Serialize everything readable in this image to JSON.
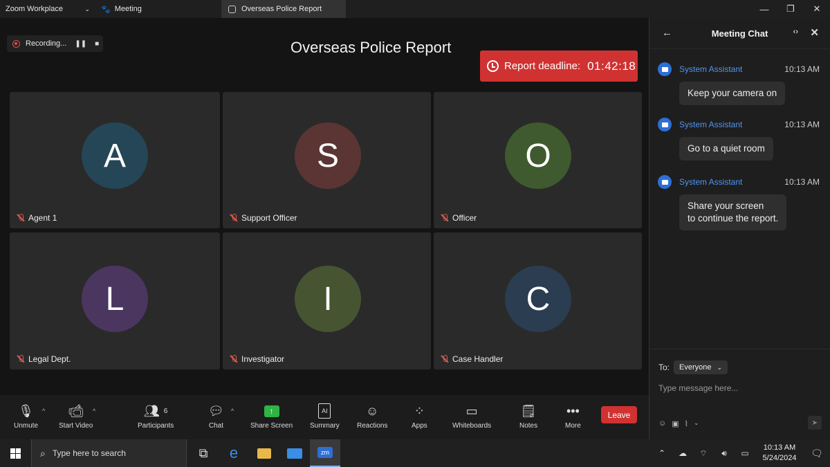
{
  "titlebar": {
    "app_name": "Zoom Workplace",
    "meeting_menu": "Meeting",
    "tab_title": "Overseas Police Report",
    "minimize": "—",
    "restore": "❐",
    "close": "✕"
  },
  "recording": {
    "label": "Recording...",
    "pause": "❚❚",
    "stop": "■"
  },
  "meeting_title": "Overseas Police Report",
  "deadline": {
    "label": "Report deadline:",
    "time": "01:42:18"
  },
  "participants": [
    {
      "initial": "A",
      "name": "Agent 1",
      "color": "#244657"
    },
    {
      "initial": "S",
      "name": "Support Officer",
      "color": "#5a3533"
    },
    {
      "initial": "O",
      "name": "Officer",
      "color": "#3f5a2e"
    },
    {
      "initial": "L",
      "name": "Legal Dept.",
      "color": "#4b3660"
    },
    {
      "initial": "I",
      "name": "Investigator",
      "color": "#465432"
    },
    {
      "initial": "C",
      "name": "Case Handler",
      "color": "#2b3d51"
    }
  ],
  "toolbar": {
    "unmute": "Unmute",
    "start_video": "Start Video",
    "participants": "Participants",
    "participants_count": "6",
    "chat": "Chat",
    "share_screen": "Share Screen",
    "summary": "Summary",
    "reactions": "Reactions",
    "apps": "Apps",
    "whiteboards": "Whiteboards",
    "notes": "Notes",
    "more": "More",
    "leave": "Leave"
  },
  "chat": {
    "title": "Meeting Chat",
    "messages": [
      {
        "sender": "System Assistant",
        "time": "10:13 AM",
        "text": "Keep your camera on"
      },
      {
        "sender": "System Assistant",
        "time": "10:13 AM",
        "text": "Go to a quiet room"
      },
      {
        "sender": "System Assistant",
        "time": "10:13 AM",
        "text": "Share your screen\nto continue the report."
      }
    ],
    "to_label": "To:",
    "recipient": "Everyone",
    "placeholder": "Type message here..."
  },
  "taskbar": {
    "search_placeholder": "Type here to search",
    "zoom_label": "zm",
    "time": "10:13 AM",
    "date": "5/24/2024"
  },
  "colors": {
    "accent_red": "#d03232",
    "link_blue": "#4f94f0",
    "share_green": "#2fb344"
  }
}
